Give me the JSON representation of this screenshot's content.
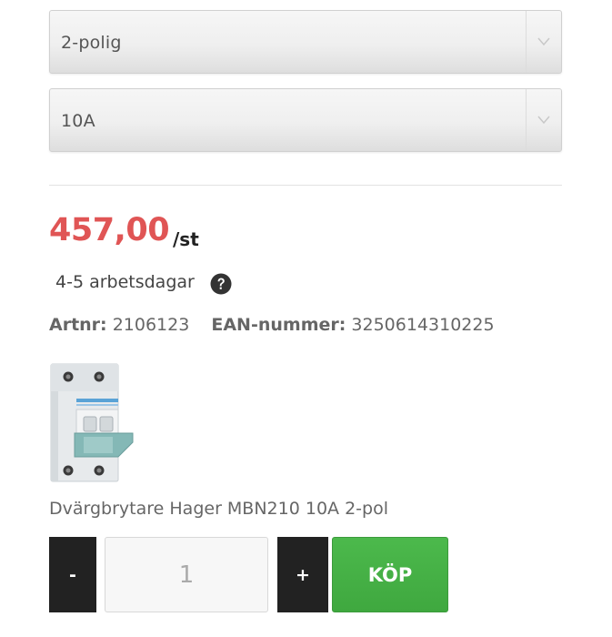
{
  "options": {
    "poles": {
      "selected": "2-polig"
    },
    "current": {
      "selected": "10A"
    }
  },
  "price": {
    "amount": "457,00",
    "unit": "/st"
  },
  "delivery": {
    "text": "4-5 arbetsdagar",
    "help_icon": "question-circle-icon"
  },
  "meta": {
    "artnr_label": "Artnr:",
    "artnr_value": "2106123",
    "ean_label": "EAN-nummer:",
    "ean_value": "3250614310225"
  },
  "product": {
    "name": "Dvärgbrytare Hager MBN210 10A 2-pol"
  },
  "cart": {
    "minus_label": "-",
    "quantity": "1",
    "plus_label": "+",
    "buy_label": "KÖP"
  },
  "colors": {
    "price": "#e05555",
    "buy_button": "#45b045",
    "stepper": "#222222"
  }
}
